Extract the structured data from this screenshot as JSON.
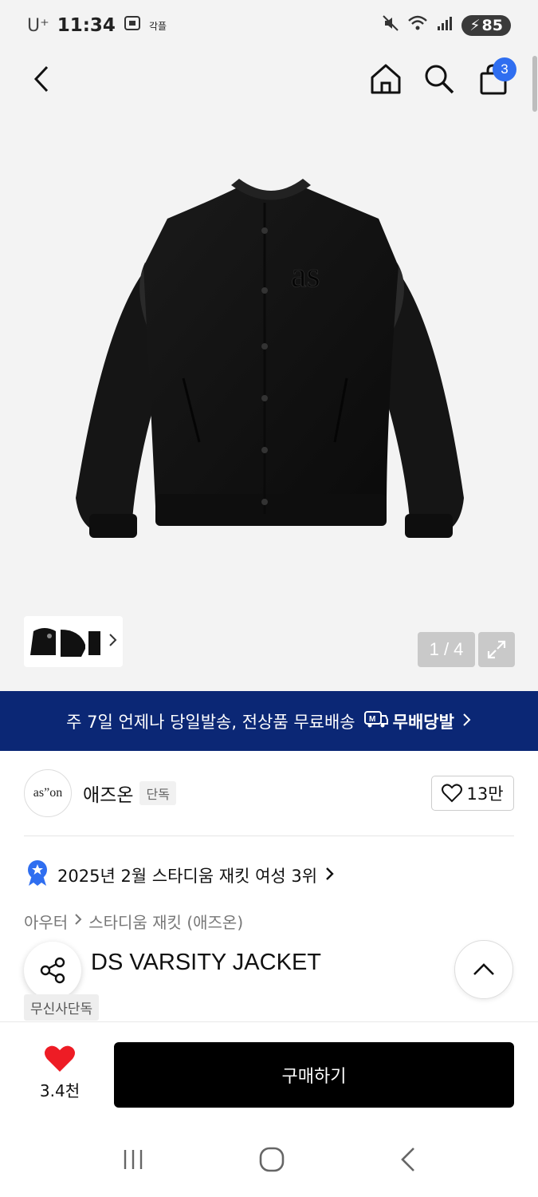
{
  "status_bar": {
    "carrier": "U⁺",
    "time": "11:34",
    "extra": "각플",
    "battery": "85"
  },
  "nav": {
    "cart_count": "3"
  },
  "gallery": {
    "page_indicator": "1 / 4",
    "image_logo_text": "as"
  },
  "banner": {
    "text": "주 7일 언제나 당일발송, 전상품 무료배송",
    "brand_icon": "M",
    "brand": "무배당발"
  },
  "brand": {
    "logo_text": "as”on",
    "name": "애즈온",
    "tag": "단독",
    "likes": "13만"
  },
  "ranking": {
    "text": "2025년 2월 스타디움 재킷 여성 3위"
  },
  "breadcrumb": {
    "category": "아우터",
    "subcategory": "스타디움 재킷 (애즈온)"
  },
  "product": {
    "title": "DS VARSITY JACKET",
    "exclusive_tag": "무신사단독"
  },
  "bottom_bar": {
    "wish_count": "3.4천",
    "buy_label": "구매하기"
  },
  "colors": {
    "banner_bg": "#0b2775",
    "badge_blue": "#2f6ef0",
    "heart_red": "#ee1c25"
  }
}
